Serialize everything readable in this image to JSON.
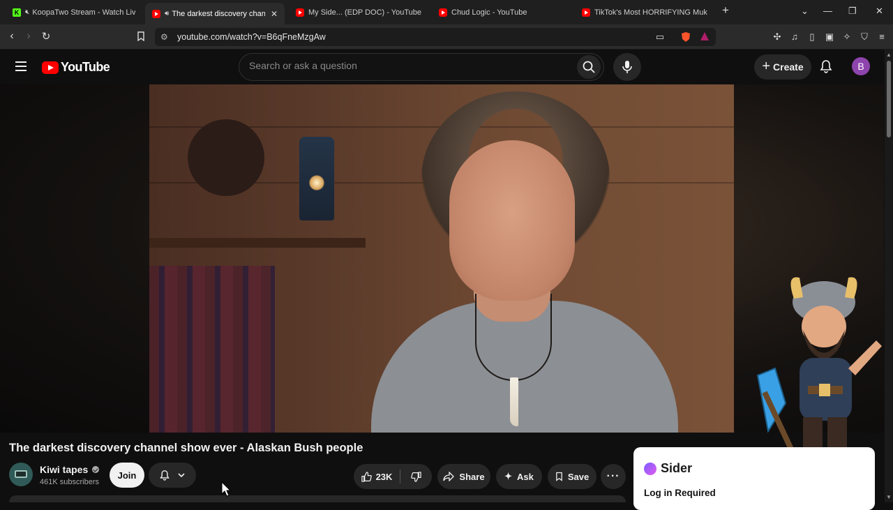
{
  "browser": {
    "tabs": [
      {
        "label": "KoopaTwo Stream - Watch Live o",
        "favicon": "kick-icon",
        "audio": "muted"
      },
      {
        "label": "The darkest discovery channe",
        "favicon": "youtube-icon",
        "audio": "playing",
        "active": true
      },
      {
        "label": "My Side... (EDP DOC) - YouTube",
        "favicon": "youtube-icon"
      },
      {
        "label": "Chud Logic - YouTube",
        "favicon": "youtube-icon"
      },
      {
        "label": "TikTok's Most HORRIFYING Mukbang",
        "favicon": "youtube-icon"
      }
    ],
    "url": "youtube.com/watch?v=B6qFneMzgAw"
  },
  "youtube": {
    "logo_text": "YouTube",
    "search_placeholder": "Search or ask a question",
    "create_label": "Create",
    "avatar_letter": "B"
  },
  "video": {
    "title": "The darkest discovery channel show ever - Alaskan Bush people",
    "channel_name": "Kiwi tapes",
    "subscribers": "461K subscribers",
    "join_label": "Join",
    "likes": "23K",
    "share_label": "Share",
    "ask_label": "Ask",
    "save_label": "Save"
  },
  "sider": {
    "brand": "Sider",
    "status": "Log in Required"
  },
  "colors": {
    "youtube_red": "#ff0000",
    "background": "#0f0f0f",
    "pill": "#272727",
    "avatar": "#8e44ad"
  }
}
